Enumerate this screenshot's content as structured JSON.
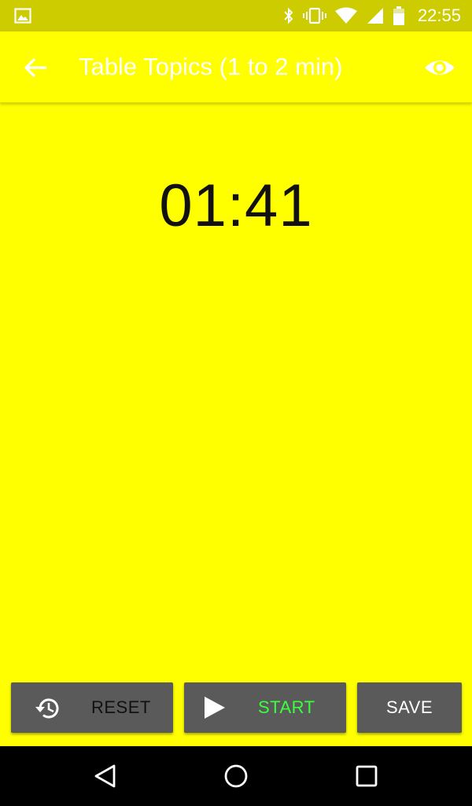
{
  "status_bar": {
    "time": "22:55",
    "icons": [
      "image-icon",
      "bluetooth-icon",
      "vibrate-icon",
      "wifi-icon",
      "signal-icon",
      "battery-icon"
    ]
  },
  "app_bar": {
    "title": "Table Topics (1 to 2 min)",
    "back_icon": "arrow-back-icon",
    "visibility_icon": "eye-icon"
  },
  "timer": {
    "display": "01:41"
  },
  "buttons": {
    "reset_label": "RESET",
    "start_label": "START",
    "save_label": "SAVE"
  },
  "colors": {
    "background": "#ffff00",
    "status_bar": "#cccc00",
    "button": "#5a5a5a",
    "start_text": "#3cff3c"
  },
  "nav_bar": {
    "icons": [
      "back-triangle-icon",
      "home-circle-icon",
      "recents-square-icon"
    ]
  }
}
